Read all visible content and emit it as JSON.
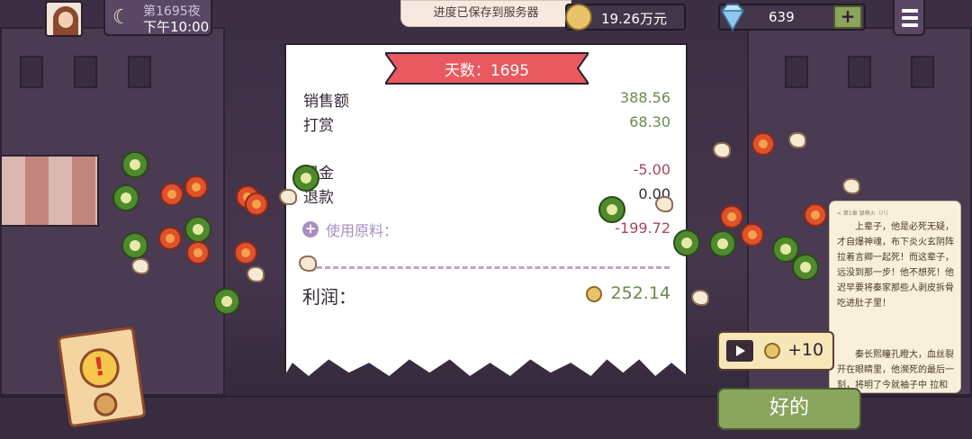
{
  "hud": {
    "night_label": "第1695夜",
    "time_label": "下午10:00",
    "save_toast": "进度已保存到服务器",
    "money": "19.26万元",
    "gems": "639",
    "gems_add": "+"
  },
  "receipt": {
    "title": "天数：1695",
    "sales_label": "销售额",
    "sales_value": "388.56",
    "tips_label": "打赏",
    "tips_value": "68.30",
    "rent_label": "租金",
    "rent_value": "-5.00",
    "refund_label": "退款",
    "refund_value": "0.00",
    "ingredients_label": "使用原料：",
    "ingredients_value": "-199.72",
    "profit_label": "利润：",
    "profit_value": "252.14"
  },
  "story": {
    "header": "< 第1章  银哨火（八）",
    "p1": "上辈子，他是必死无疑，才自爆神魂，布下炎火玄阴阵拉着言卿一起死！而这辈子，远没到那一步！他不想死！他迟早要将秦家那些人剥皮拆骨吃进肚子里！",
    "p2": "秦长熙瞳孔瞪大，血丝裂开在眼睛里，他濒死的最后一刻，将明了今就袖子中 拉和目"
  },
  "actions": {
    "ad_reward": "+10",
    "ok": "好的"
  }
}
